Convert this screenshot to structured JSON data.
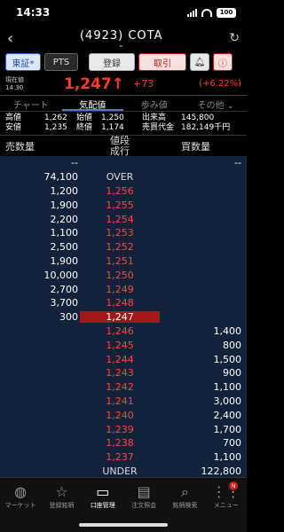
{
  "status": {
    "time": "14:33",
    "battery": "100"
  },
  "header": {
    "title": "(4923) COTA"
  },
  "buttons": {
    "market": "東証*",
    "pts": "PTS",
    "register": "登録",
    "trade": "取引"
  },
  "price": {
    "label": "現在値",
    "time": "14:30",
    "value": "1,247",
    "arrow": "↑",
    "change": "+73",
    "percent": "(+6.22%)"
  },
  "tabs": [
    "チャート",
    "気配値",
    "歩み値",
    "その他"
  ],
  "stats": {
    "high_label": "高値",
    "high": "1,262",
    "open_label": "始値",
    "open": "1,250",
    "volume_label": "出来高",
    "volume": "145,800",
    "low_label": "安値",
    "low": "1,235",
    "close_label": "終値",
    "close": "1,174",
    "turnover_label": "売買代金",
    "turnover": "182,149千円"
  },
  "columns": {
    "ask": "売数量",
    "price1": "値段",
    "price2": "成行",
    "bid": "買数量"
  },
  "book": [
    {
      "ask": "--",
      "price": "",
      "bid": "--"
    },
    {
      "ask": "74,100",
      "price": "OVER",
      "bid": ""
    },
    {
      "ask": "1,200",
      "price": "1,256",
      "bid": ""
    },
    {
      "ask": "1,900",
      "price": "1,255",
      "bid": ""
    },
    {
      "ask": "2,200",
      "price": "1,254",
      "bid": ""
    },
    {
      "ask": "1,100",
      "price": "1,253",
      "bid": ""
    },
    {
      "ask": "2,500",
      "price": "1,252",
      "bid": ""
    },
    {
      "ask": "1,900",
      "price": "1,251",
      "bid": ""
    },
    {
      "ask": "10,000",
      "price": "1,250",
      "bid": ""
    },
    {
      "ask": "2,700",
      "price": "1,249",
      "bid": ""
    },
    {
      "ask": "3,700",
      "price": "1,248",
      "bid": ""
    },
    {
      "ask": "300",
      "price": "1,247",
      "bid": ""
    },
    {
      "ask": "",
      "price": "1,246",
      "bid": "1,400"
    },
    {
      "ask": "",
      "price": "1,245",
      "bid": "800"
    },
    {
      "ask": "",
      "price": "1,244",
      "bid": "1,500"
    },
    {
      "ask": "",
      "price": "1,243",
      "bid": "900"
    },
    {
      "ask": "",
      "price": "1,242",
      "bid": "1,100"
    },
    {
      "ask": "",
      "price": "1,241",
      "bid": "3,000"
    },
    {
      "ask": "",
      "price": "1,240",
      "bid": "2,400"
    },
    {
      "ask": "",
      "price": "1,239",
      "bid": "1,700"
    },
    {
      "ask": "",
      "price": "1,238",
      "bid": "700"
    },
    {
      "ask": "",
      "price": "1,237",
      "bid": "1,100"
    },
    {
      "ask": "",
      "price": "UNDER",
      "bid": "122,800"
    }
  ],
  "nav": [
    "マーケット",
    "登録銘柄",
    "口座管理",
    "注文照会",
    "銘柄検索",
    "メニュー"
  ],
  "badge": "N",
  "colors": {
    "up": "#ff3b30",
    "current_bg": "#a31818",
    "book_bg": "#12223a"
  }
}
